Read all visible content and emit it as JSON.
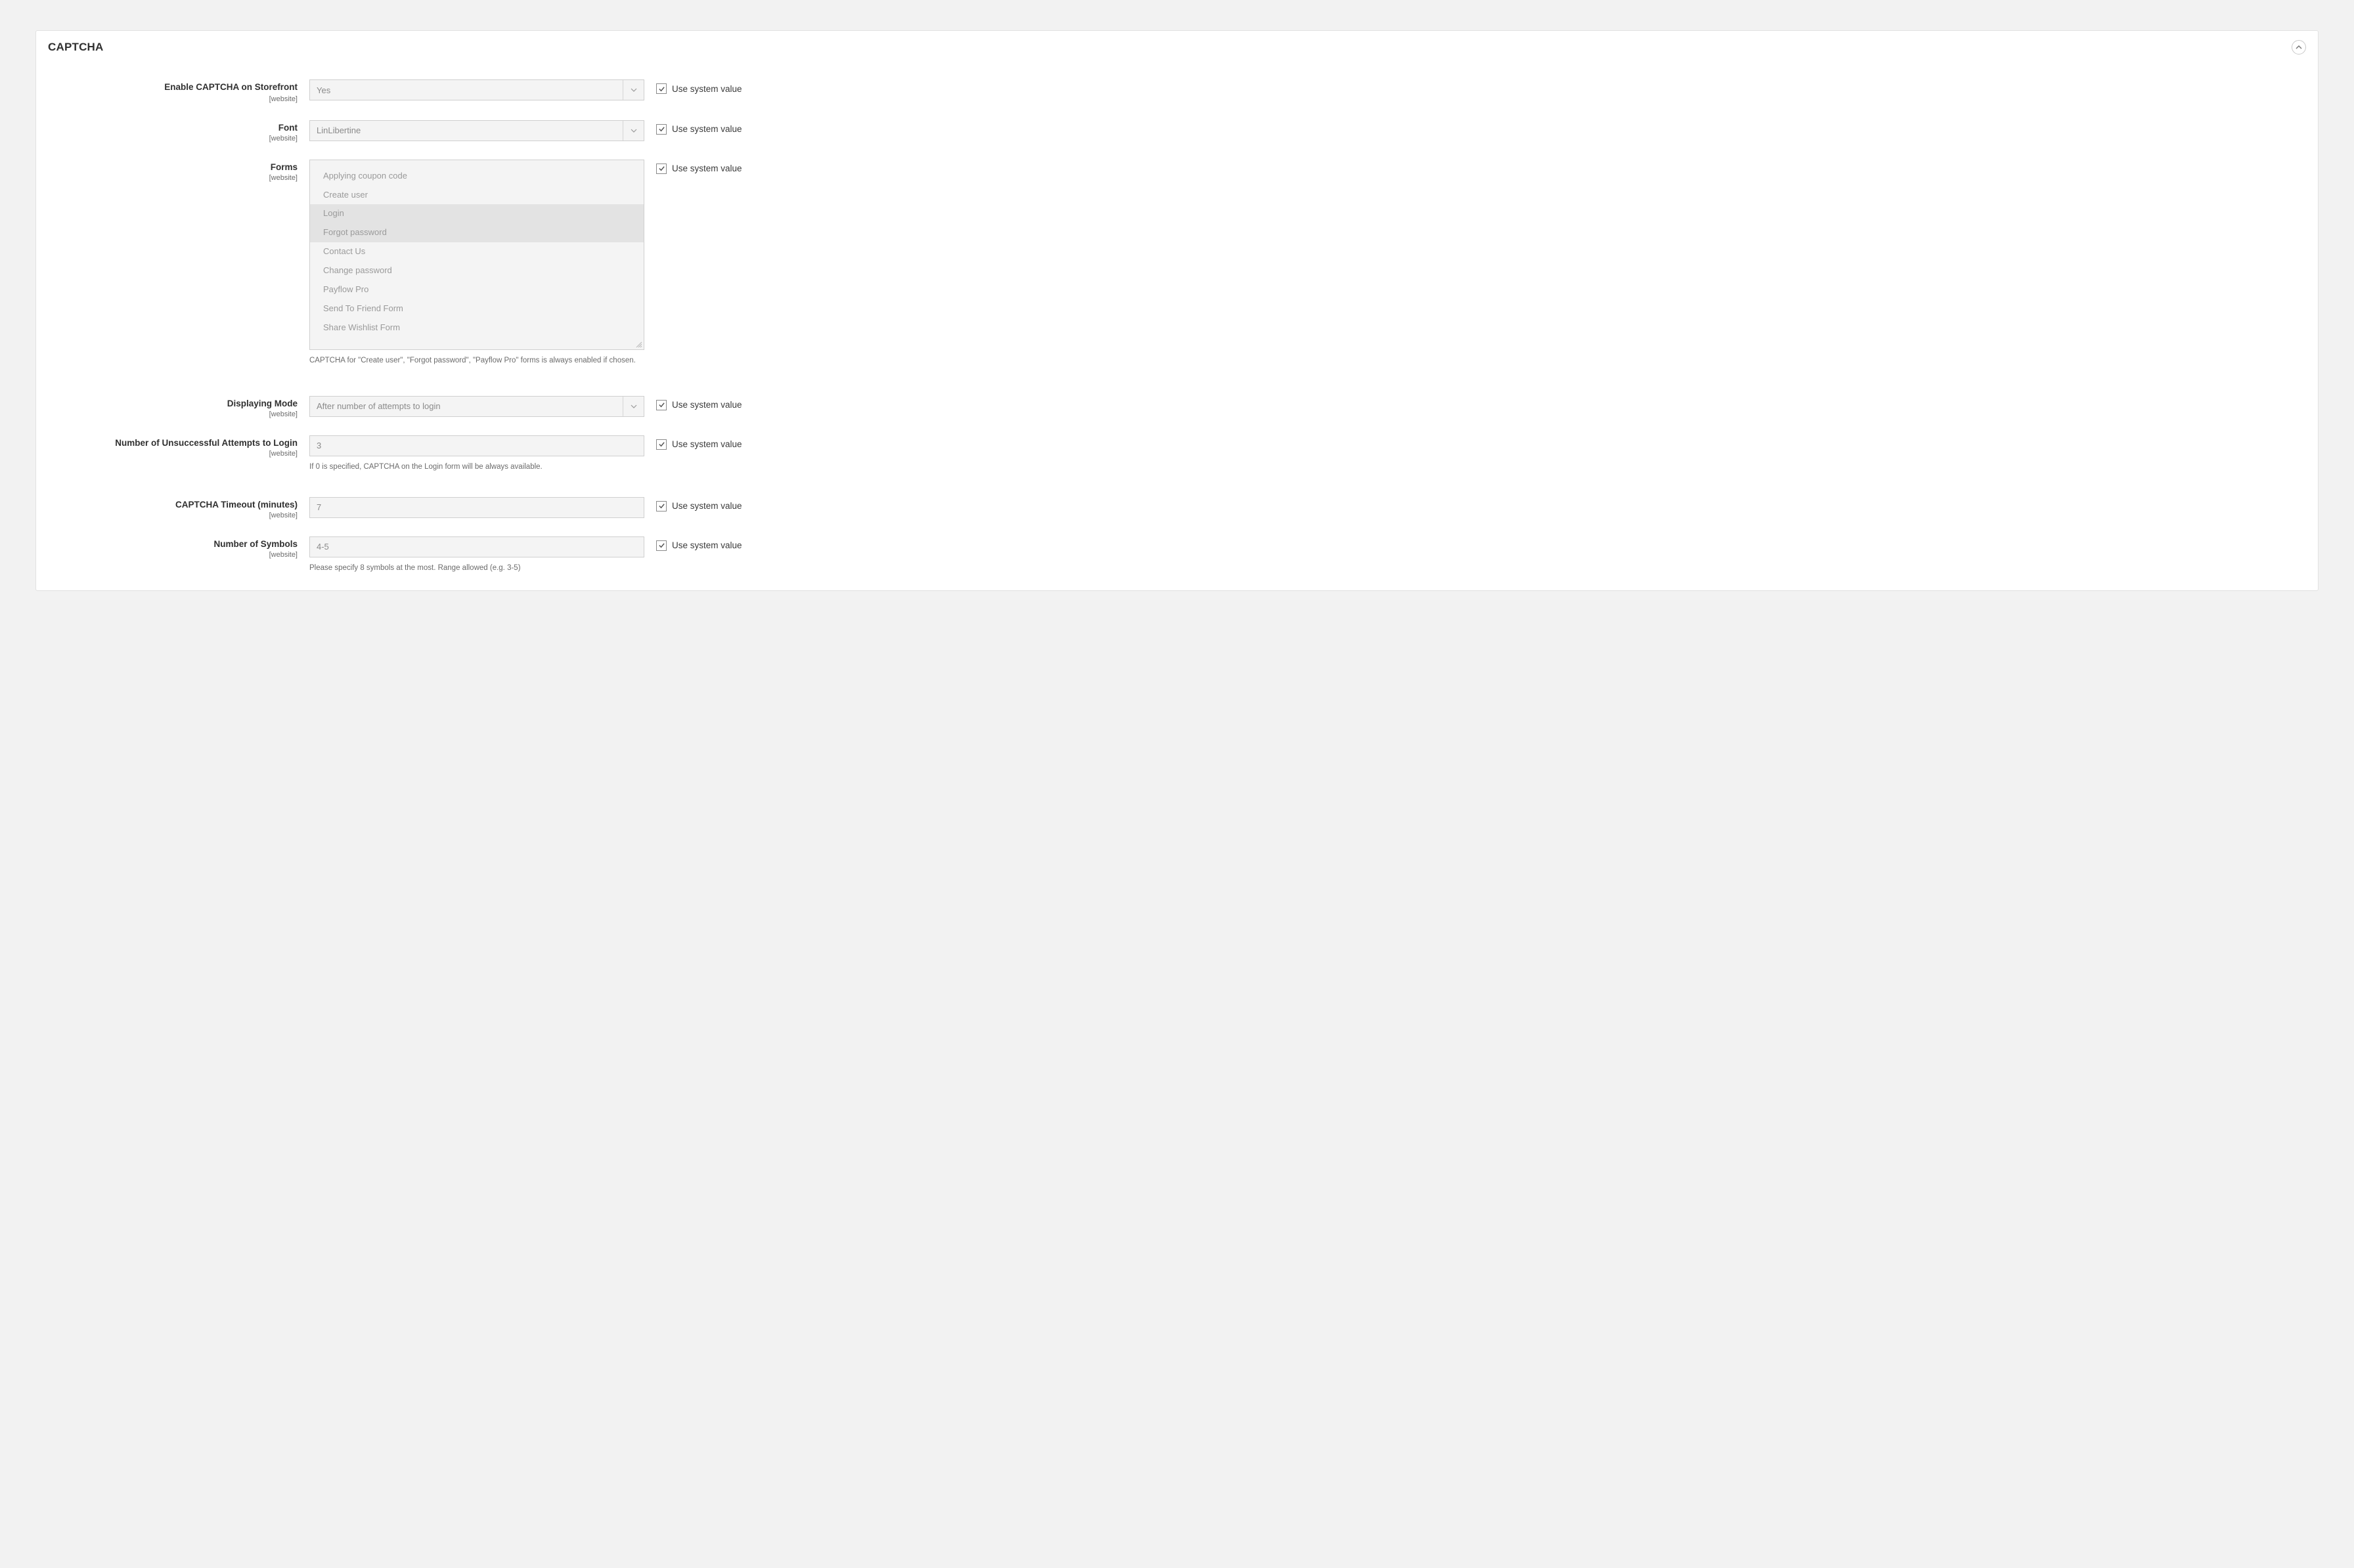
{
  "panel": {
    "title": "CAPTCHA"
  },
  "common": {
    "scope": "[website]",
    "inheritLabel": "Use system value"
  },
  "fields": {
    "enable": {
      "label": "Enable CAPTCHA on Storefront",
      "value": "Yes"
    },
    "font": {
      "label": "Font",
      "value": "LinLibertine"
    },
    "forms": {
      "label": "Forms",
      "options": [
        {
          "label": "Applying coupon code",
          "selected": false
        },
        {
          "label": "Create user",
          "selected": false
        },
        {
          "label": "Login",
          "selected": true
        },
        {
          "label": "Forgot password",
          "selected": true
        },
        {
          "label": "Contact Us",
          "selected": false
        },
        {
          "label": "Change password",
          "selected": false
        },
        {
          "label": "Payflow Pro",
          "selected": false
        },
        {
          "label": "Send To Friend Form",
          "selected": false
        },
        {
          "label": "Share Wishlist Form",
          "selected": false
        }
      ],
      "help": "CAPTCHA for \"Create user\", \"Forgot password\", \"Payflow Pro\" forms is always enabled if chosen."
    },
    "mode": {
      "label": "Displaying Mode",
      "value": "After number of attempts to login"
    },
    "attempts": {
      "label": "Number of Unsuccessful Attempts to Login",
      "value": "3",
      "help": "If 0 is specified, CAPTCHA on the Login form will be always available."
    },
    "timeout": {
      "label": "CAPTCHA Timeout (minutes)",
      "value": "7"
    },
    "symbols": {
      "label": "Number of Symbols",
      "value": "4-5",
      "help": "Please specify 8 symbols at the most. Range allowed (e.g. 3-5)"
    }
  }
}
